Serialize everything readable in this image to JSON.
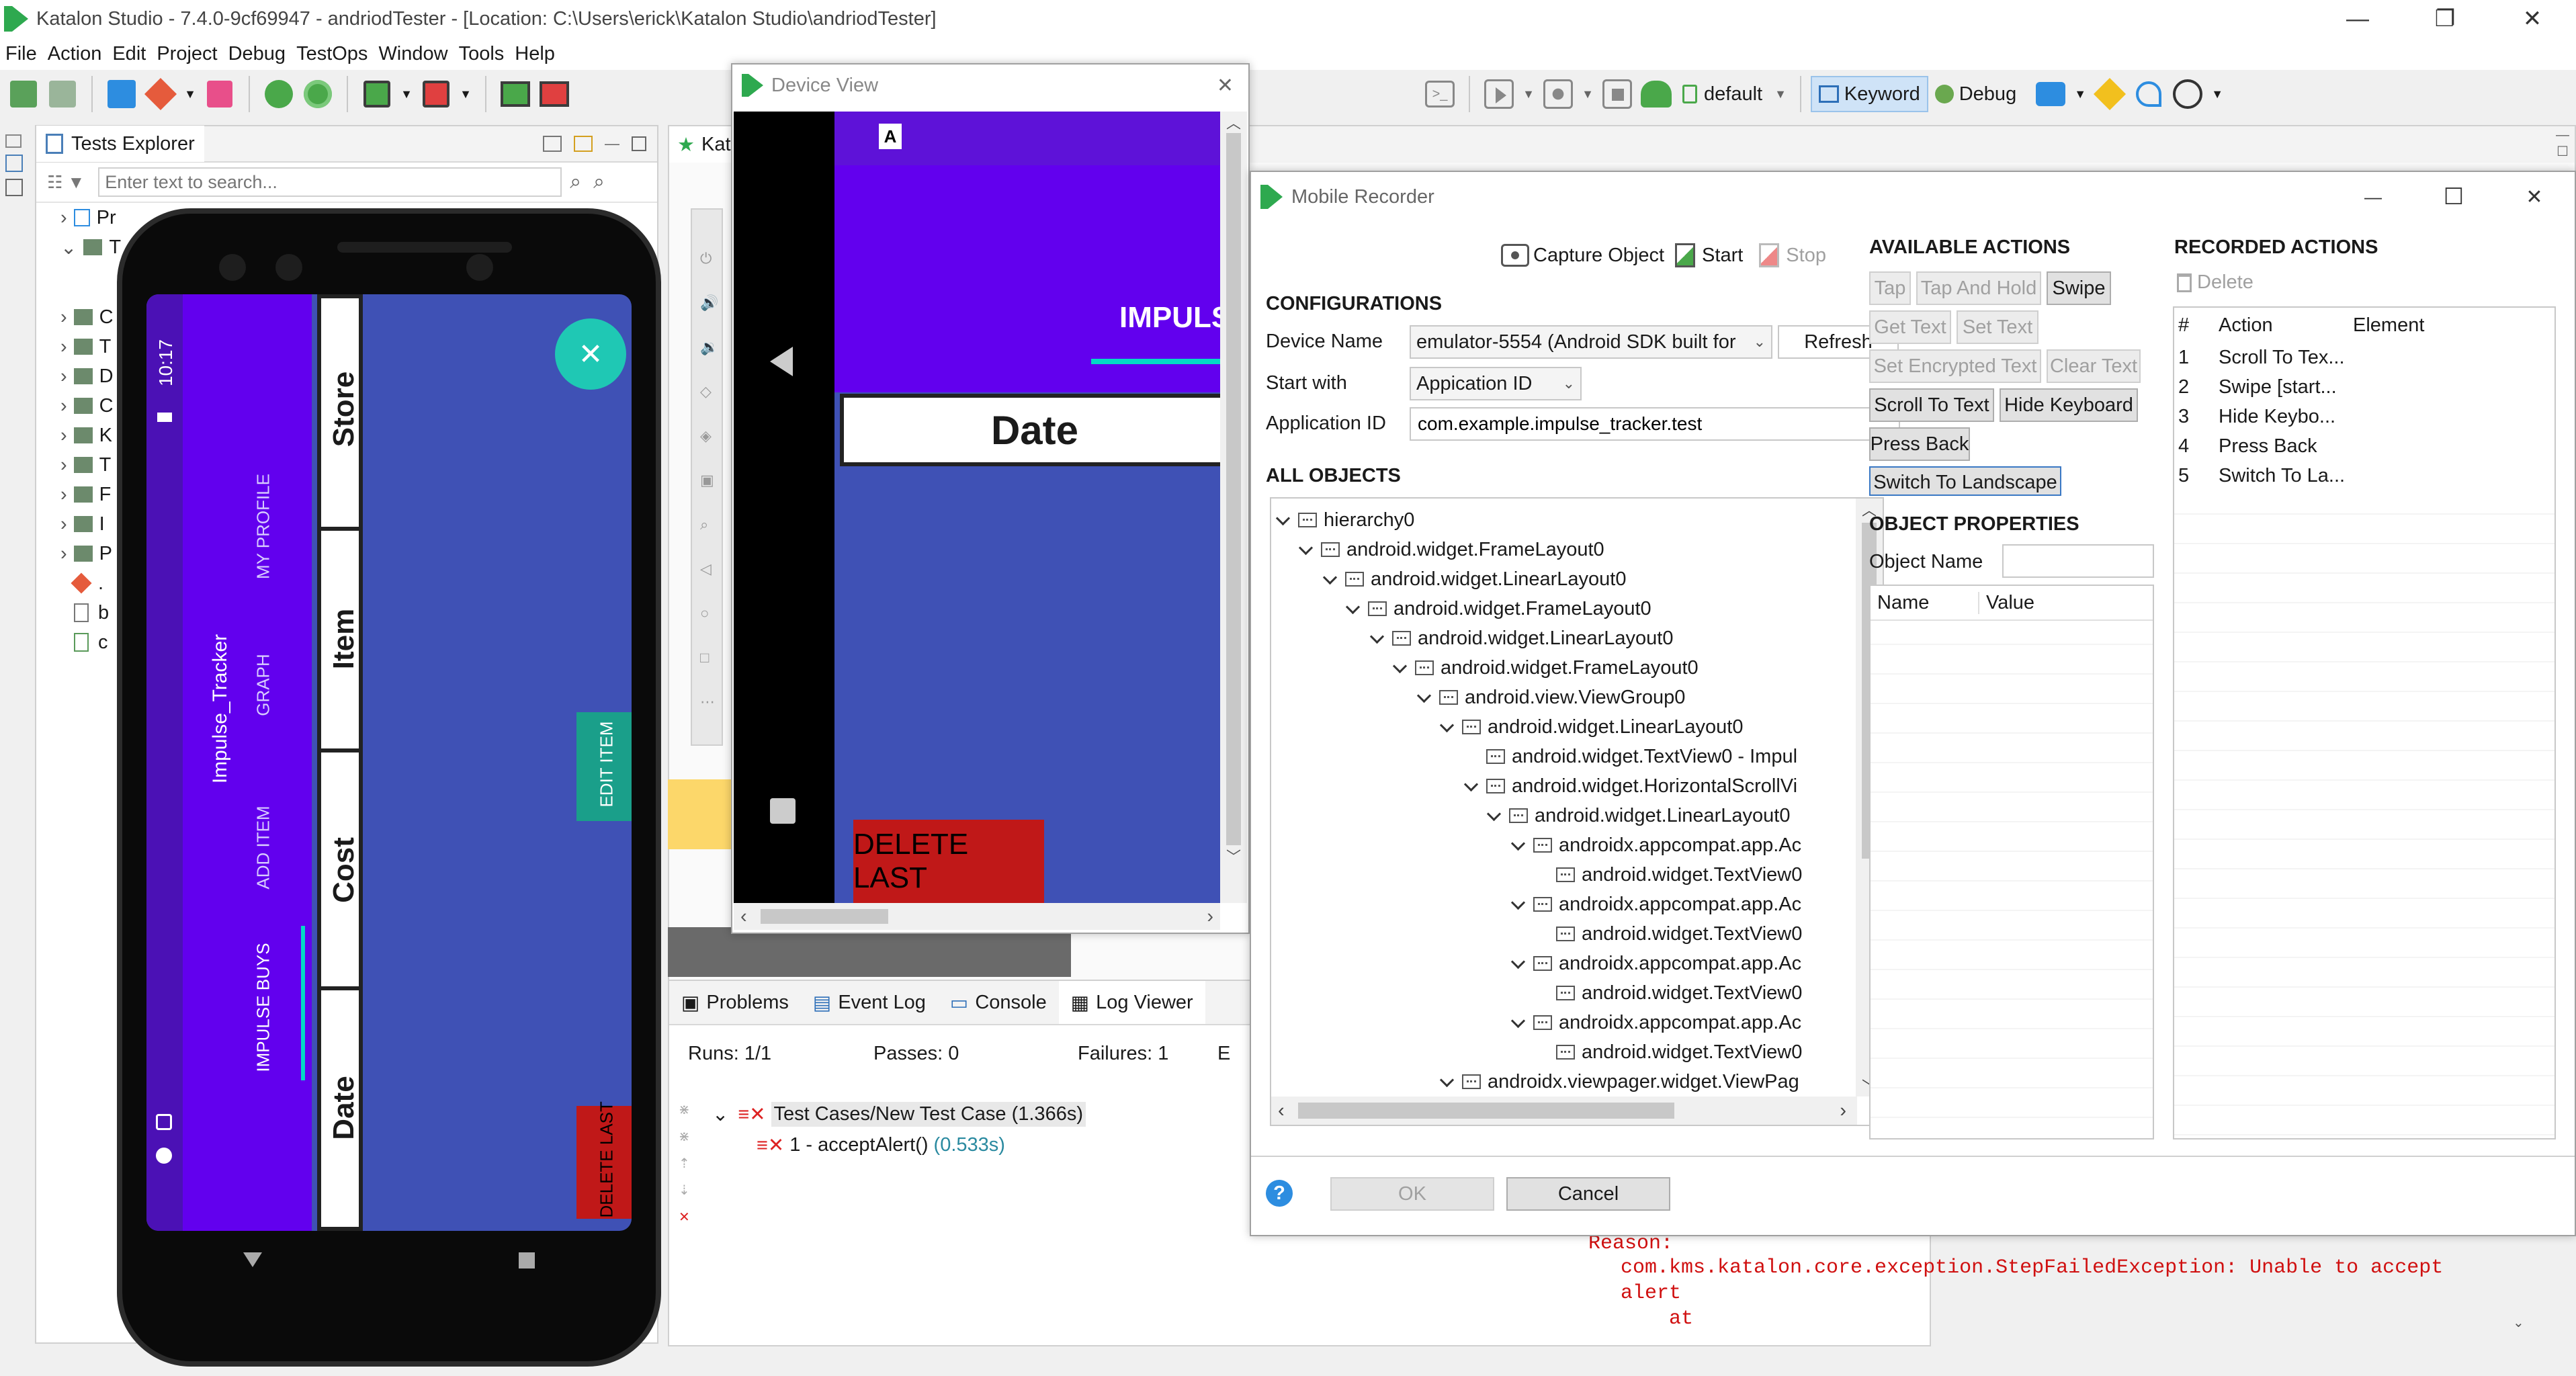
{
  "app": {
    "title": "Katalon Studio - 7.4.0-9cf69947 - andriodTester - [Location: C:\\Users\\erick\\Katalon Studio\\andriodTester]",
    "menu": [
      "File",
      "Action",
      "Edit",
      "Project",
      "Debug",
      "TestOps",
      "Window",
      "Tools",
      "Help"
    ],
    "toolbar": {
      "profile": "default",
      "keyword": "Keyword",
      "debug": "Debug"
    }
  },
  "explorer": {
    "title": "Tests Explorer",
    "search_placeholder": "Enter text to search...",
    "items": [
      "Pr",
      "T",
      "C",
      "T",
      "D",
      "C",
      "K",
      "T",
      "F",
      "I",
      "P",
      ".",
      "b",
      "c"
    ]
  },
  "editor_tab": "Kata",
  "device_view": {
    "title": "Device View",
    "impulse": "IMPULS",
    "date": "Date",
    "delete_last": "DELETE LAST",
    "logo": "A"
  },
  "phone": {
    "time": "10:17",
    "app_name": "Impulse_Tracker",
    "menu": [
      "MY PROFILE",
      "GRAPH",
      "ADD ITEM",
      "IMPULSE BUYS"
    ],
    "columns": [
      "Store",
      "Item",
      "Cost",
      "Date"
    ],
    "edit_item": "EDIT ITEM",
    "delete_last": "DELETE LAST"
  },
  "log": {
    "tabs": [
      "Problems",
      "Event Log",
      "Console",
      "Log Viewer"
    ],
    "runs": "Runs: 1/1",
    "passes": "Passes: 0",
    "failures": "Failures: 1",
    "e": "E",
    "test_case": "Test Cases/New Test Case (1.366s)",
    "step": "1 - acceptAlert()",
    "step_time": "(0.533s)",
    "reason": "Reason:",
    "exception": "com.kms.katalon.core.exception.StepFailedException: Unable to accept",
    "exception2": "alert",
    "at": "at"
  },
  "recorder": {
    "title": "Mobile Recorder",
    "capture": "Capture Object",
    "start": "Start",
    "stop": "Stop",
    "config_title": "CONFIGURATIONS",
    "device_label": "Device Name",
    "device_value": "emulator-5554 (Android SDK built for",
    "refresh": "Refresh",
    "start_with_label": "Start with",
    "start_with_value": "Appication ID",
    "app_id_label": "Application ID",
    "app_id_value": "com.example.impulse_tracker.test",
    "all_objects": "ALL OBJECTS",
    "tree": [
      "hierarchy0",
      "android.widget.FrameLayout0",
      "android.widget.LinearLayout0",
      "android.widget.FrameLayout0",
      "android.widget.LinearLayout0",
      "android.widget.FrameLayout0",
      "android.view.ViewGroup0",
      "android.widget.LinearLayout0",
      "android.widget.TextView0 - Impul",
      "android.widget.HorizontalScrollVi",
      "android.widget.LinearLayout0",
      "androidx.appcompat.app.Ac",
      "android.widget.TextView0",
      "androidx.appcompat.app.Ac",
      "android.widget.TextView0",
      "androidx.appcompat.app.Ac",
      "android.widget.TextView0",
      "androidx.appcompat.app.Ac",
      "android.widget.TextView0",
      "androidx.viewpager.widget.ViewPag"
    ],
    "available_title": "AVAILABLE ACTIONS",
    "actions": [
      [
        "Tap",
        "Tap And Hold",
        "Swipe"
      ],
      [
        "Get Text",
        "Set Text"
      ],
      [
        "Set Encrypted Text",
        "Clear Text"
      ],
      [
        "Scroll To Text",
        "Hide Keyboard"
      ],
      [
        "Press Back"
      ],
      [
        "Switch To Landscape"
      ]
    ],
    "props_title": "OBJECT PROPERTIES",
    "object_name_label": "Object Name",
    "col_name": "Name",
    "col_value": "Value",
    "recorded_title": "RECORDED ACTIONS",
    "delete": "Delete",
    "col_hash": "#",
    "col_action": "Action",
    "col_element": "Element",
    "recorded": [
      {
        "n": "1",
        "a": "Scroll To Tex..."
      },
      {
        "n": "2",
        "a": "Swipe [start..."
      },
      {
        "n": "3",
        "a": "Hide Keybo..."
      },
      {
        "n": "4",
        "a": "Press Back"
      },
      {
        "n": "5",
        "a": "Switch To La..."
      }
    ],
    "ok": "OK",
    "cancel": "Cancel",
    "help": "?"
  }
}
